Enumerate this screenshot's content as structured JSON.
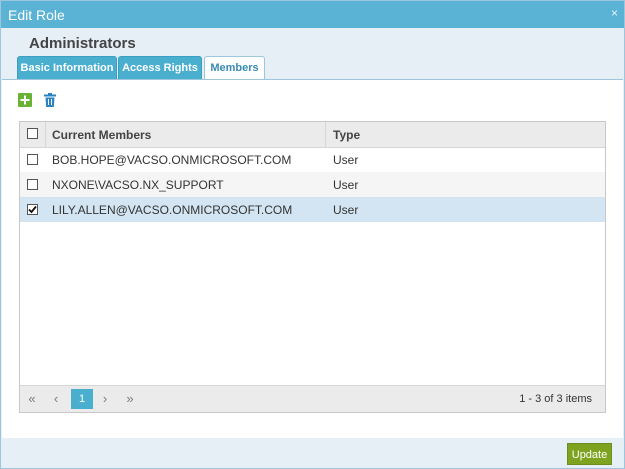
{
  "dialog": {
    "title": "Edit Role",
    "close_glyph": "×"
  },
  "role": {
    "name": "Administrators"
  },
  "tabs": [
    {
      "label": "Basic Information",
      "active": false
    },
    {
      "label": "Access Rights",
      "active": false
    },
    {
      "label": "Members",
      "active": true
    }
  ],
  "toolbar": {
    "add_icon": "plus-icon",
    "delete_icon": "trash-icon"
  },
  "grid": {
    "columns": [
      "Current Members",
      "Type"
    ],
    "rows": [
      {
        "member": "BOB.HOPE@VACSO.ONMICROSOFT.COM",
        "type": "User",
        "checked": false
      },
      {
        "member": "NXONE\\VACSO.NX_SUPPORT",
        "type": "User",
        "checked": false
      },
      {
        "member": "LILY.ALLEN@VACSO.ONMICROSOFT.COM",
        "type": "User",
        "checked": true
      }
    ]
  },
  "pager": {
    "first": "«",
    "prev": "‹",
    "page": "1",
    "next": "›",
    "last": "»",
    "info": "1 - 3 of 3 items"
  },
  "footer": {
    "update_label": "Update"
  },
  "colors": {
    "titlebar": "#5ab3d4",
    "tab": "#4aaecf",
    "selected_row": "#d3e5f2",
    "update": "#7da321",
    "add": "#6ab233",
    "delete": "#2a83c1"
  }
}
